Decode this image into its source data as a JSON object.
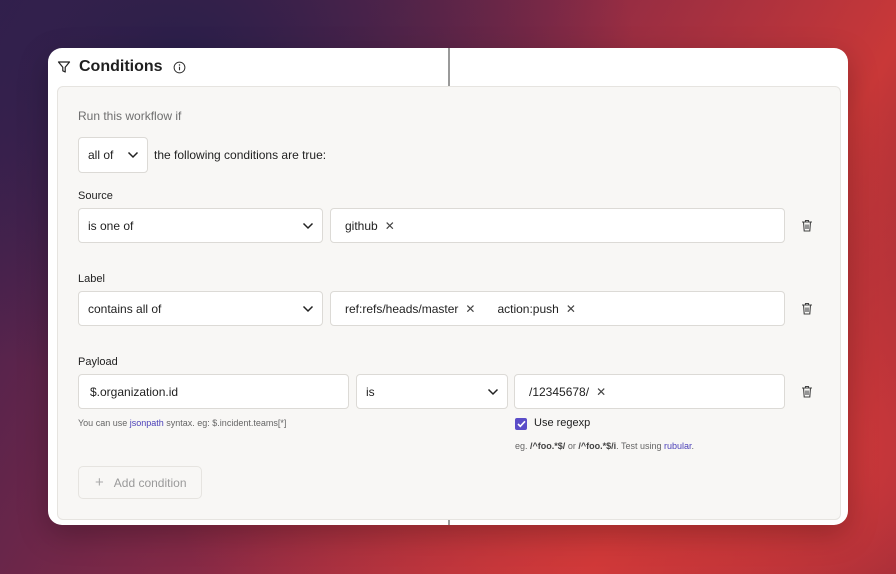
{
  "header": {
    "title": "Conditions",
    "filter_icon": "filter-icon",
    "info_icon": "info-icon"
  },
  "intro": {
    "run_label": "Run this workflow if",
    "match_select": "all of",
    "match_suffix": "the following conditions are true:"
  },
  "conditions": {
    "source": {
      "label": "Source",
      "operator": "is one of",
      "chips": [
        "github"
      ]
    },
    "label": {
      "label": "Label",
      "operator": "contains all of",
      "chips": [
        "ref:refs/heads/master",
        "action:push"
      ]
    },
    "payload": {
      "label": "Payload",
      "path": "$.organization.id",
      "operator": "is",
      "chips": [
        "/12345678/"
      ],
      "help_prefix": "You can use",
      "help_link": "jsonpath",
      "help_suffix": "syntax. eg: $.incident.teams[*]",
      "regexp_label": "Use regexp",
      "regexp_checked": true,
      "regexp_help_prefix": "eg.",
      "regexp_example1": "/^foo.*$/",
      "regexp_or": "or",
      "regexp_example2": "/^foo.*$/i",
      "regexp_help_mid": ". Test using",
      "regexp_link": "rubular",
      "regexp_help_end": "."
    }
  },
  "add_condition": "Add condition",
  "colors": {
    "accent": "#5b4dc8",
    "link": "#4a3fb8"
  }
}
